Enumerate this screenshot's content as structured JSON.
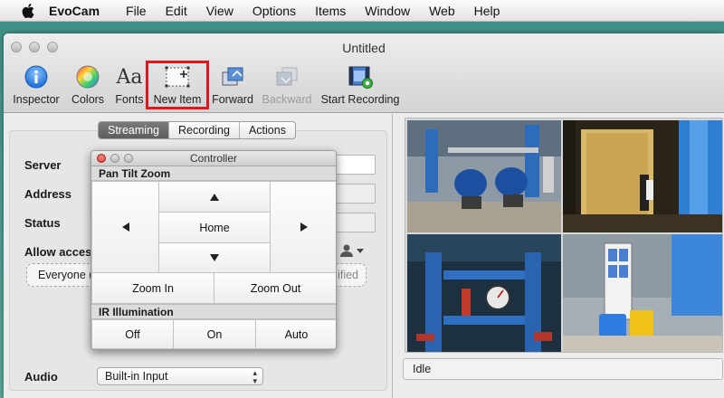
{
  "menubar": {
    "app_name": "EvoCam",
    "items": [
      "File",
      "Edit",
      "View",
      "Options",
      "Items",
      "Window",
      "Web",
      "Help"
    ]
  },
  "window": {
    "title": "Untitled"
  },
  "toolbar": {
    "inspector": "Inspector",
    "colors": "Colors",
    "fonts": "Fonts",
    "fonts_glyph": "Aa",
    "new_item": "New Item",
    "forward": "Forward",
    "backward": "Backward",
    "start_recording": "Start Recording"
  },
  "tabs": {
    "streaming": "Streaming",
    "recording": "Recording",
    "actions": "Actions",
    "selected": "Streaming"
  },
  "form": {
    "server_label": "Server",
    "address_label": "Address",
    "status_label": "Status",
    "allow_access_label": "Allow access",
    "allow_access_value": "Everyone (r",
    "allow_access_value_tail": "ified",
    "audio_label": "Audio",
    "audio_value": "Built-in Input"
  },
  "controller": {
    "title": "Controller",
    "ptz_section": "Pan Tilt Zoom",
    "home": "Home",
    "zoom_in": "Zoom In",
    "zoom_out": "Zoom Out",
    "ir_section": "IR Illumination",
    "off": "Off",
    "on": "On",
    "auto": "Auto"
  },
  "viewer": {
    "status": "Idle"
  },
  "colors": {
    "highlight": "#e0161c",
    "selected_tab": "#5d5d5d"
  }
}
